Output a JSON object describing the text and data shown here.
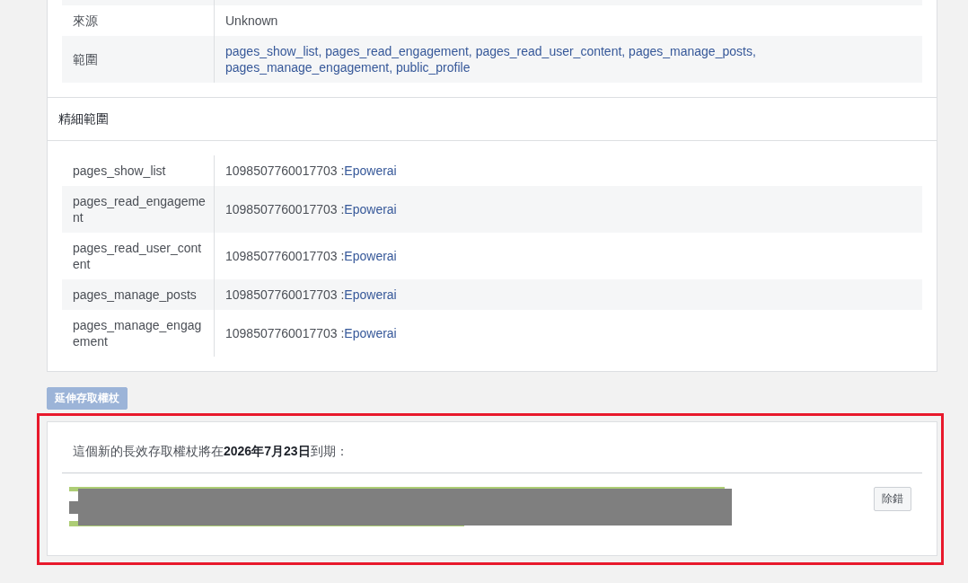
{
  "token_info": {
    "rows": [
      {
        "label": "來源",
        "value": "Unknown",
        "kind": "text"
      },
      {
        "label": "範圍",
        "value": "pages_show_list, pages_read_engagement, pages_read_user_content, pages_manage_posts, pages_manage_engagement, public_profile",
        "kind": "link"
      }
    ]
  },
  "granular_scopes": {
    "title": "精細範圍",
    "rows": [
      {
        "scope": "pages_show_list",
        "id": "1098507760017703 :",
        "page": "Epowerai"
      },
      {
        "scope": "pages_read_engagement",
        "id": "1098507760017703 :",
        "page": "Epowerai"
      },
      {
        "scope": "pages_read_user_content",
        "id": "1098507760017703 :",
        "page": "Epowerai"
      },
      {
        "scope": "pages_manage_posts",
        "id": "1098507760017703 :",
        "page": "Epowerai"
      },
      {
        "scope": "pages_manage_engagement",
        "id": "1098507760017703 :",
        "page": "Epowerai"
      }
    ]
  },
  "extend_button": {
    "label": "延伸存取權杖",
    "disabled": true
  },
  "new_token": {
    "message": "這個新的長效存取權杖將在**2026年7月23日**到期：",
    "debug_button": "除錯"
  }
}
